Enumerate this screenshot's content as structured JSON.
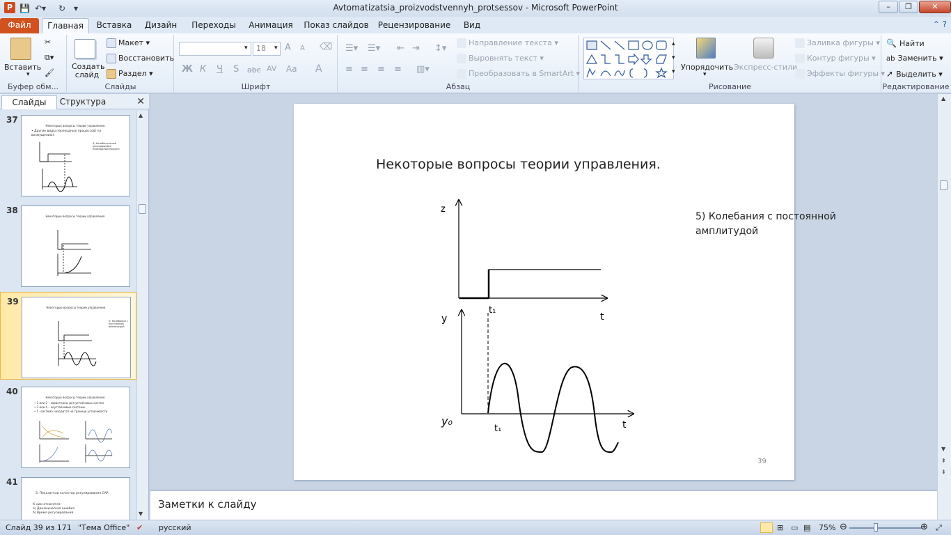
{
  "window": {
    "title": "Avtomatizatsia_proizvodstvennyh_protsessov  -  Microsoft PowerPoint",
    "app_letter": "P",
    "buttons": [
      "minimize",
      "maximize",
      "close"
    ]
  },
  "tabs": [
    "Файл",
    "Главная",
    "Вставка",
    "Дизайн",
    "Переходы",
    "Анимация",
    "Показ слайдов",
    "Рецензирование",
    "Вид"
  ],
  "ribbon": {
    "clipboard": {
      "label": "Буфер обм...",
      "paste": "Вставить"
    },
    "slides": {
      "label": "Слайды",
      "new_slide": "Создать слайд",
      "layout": "Макет",
      "reset": "Восстановить",
      "section": "Раздел"
    },
    "font": {
      "label": "Шрифт",
      "font_name": "",
      "font_size": "18",
      "bold": "Ж",
      "italic": "К",
      "underline": "Ч",
      "shadow": "S",
      "strike": "abc",
      "spacing": "AV",
      "case": "Aa",
      "color": "A",
      "grow": "A",
      "shrink": "A"
    },
    "paragraph": {
      "label": "Абзац",
      "text_direction": "Направление текста",
      "align_text": "Выровнять текст",
      "smartart": "Преобразовать в SmartArt"
    },
    "drawing": {
      "label": "Рисование",
      "arrange": "Упорядочить",
      "quick_styles": "Экспресс-стили",
      "shape_fill": "Заливка фигуры",
      "shape_outline": "Контур фигуры",
      "shape_effects": "Эффекты фигуры"
    },
    "editing": {
      "label": "Редактирование",
      "find": "Найти",
      "replace": "Заменить",
      "select": "Выделить"
    }
  },
  "left_pane": {
    "tabs": [
      "Слайды",
      "Структура"
    ],
    "thumbnails": [
      {
        "num": "37",
        "title": "Некоторые вопросы теории управления.",
        "body": "• Другие виды переходных процессов( по возмущению):",
        "note": "4) Колебательный расходящийся переходный процесс"
      },
      {
        "num": "38",
        "title": "Некоторые вопросы теории управления.",
        "body": "",
        "note": ""
      },
      {
        "num": "39",
        "title": "Некоторые вопросы теории управления.",
        "body": "",
        "note": "5) Колебания с постоянной амплитудой"
      },
      {
        "num": "40",
        "title": "Некоторые вопросы теории управления.",
        "body": "• 1 или 2 – характерны для устойчивых систем.\n• 3 или 4 – неустойчивые системы\n• 5 –система находится на границе устойчивости",
        "note": ""
      },
      {
        "num": "41",
        "title": "3. Показатели качества регулирования САР.",
        "body": "К ним относятся:\nа) Динамическая ошибка\nб) Время регулирования",
        "note": ""
      }
    ]
  },
  "slide": {
    "title": "Некоторые вопросы теории управления.",
    "side_text": "5) Колебания с постоянной амплитудой",
    "number": "39",
    "labels": {
      "z": "z",
      "t_top": "t",
      "t1_top": "t₁",
      "y": "y",
      "y0": "y₀",
      "t_bottom": "t",
      "t1_bottom": "t₁"
    }
  },
  "notes_placeholder": "Заметки к слайду",
  "status": {
    "slide_info": "Слайд 39 из 171",
    "theme": "\"Тема Office\"",
    "language": "русский",
    "zoom": "75%"
  },
  "colors": {
    "accent": "#d2521f",
    "selection": "#ffe9a8"
  }
}
